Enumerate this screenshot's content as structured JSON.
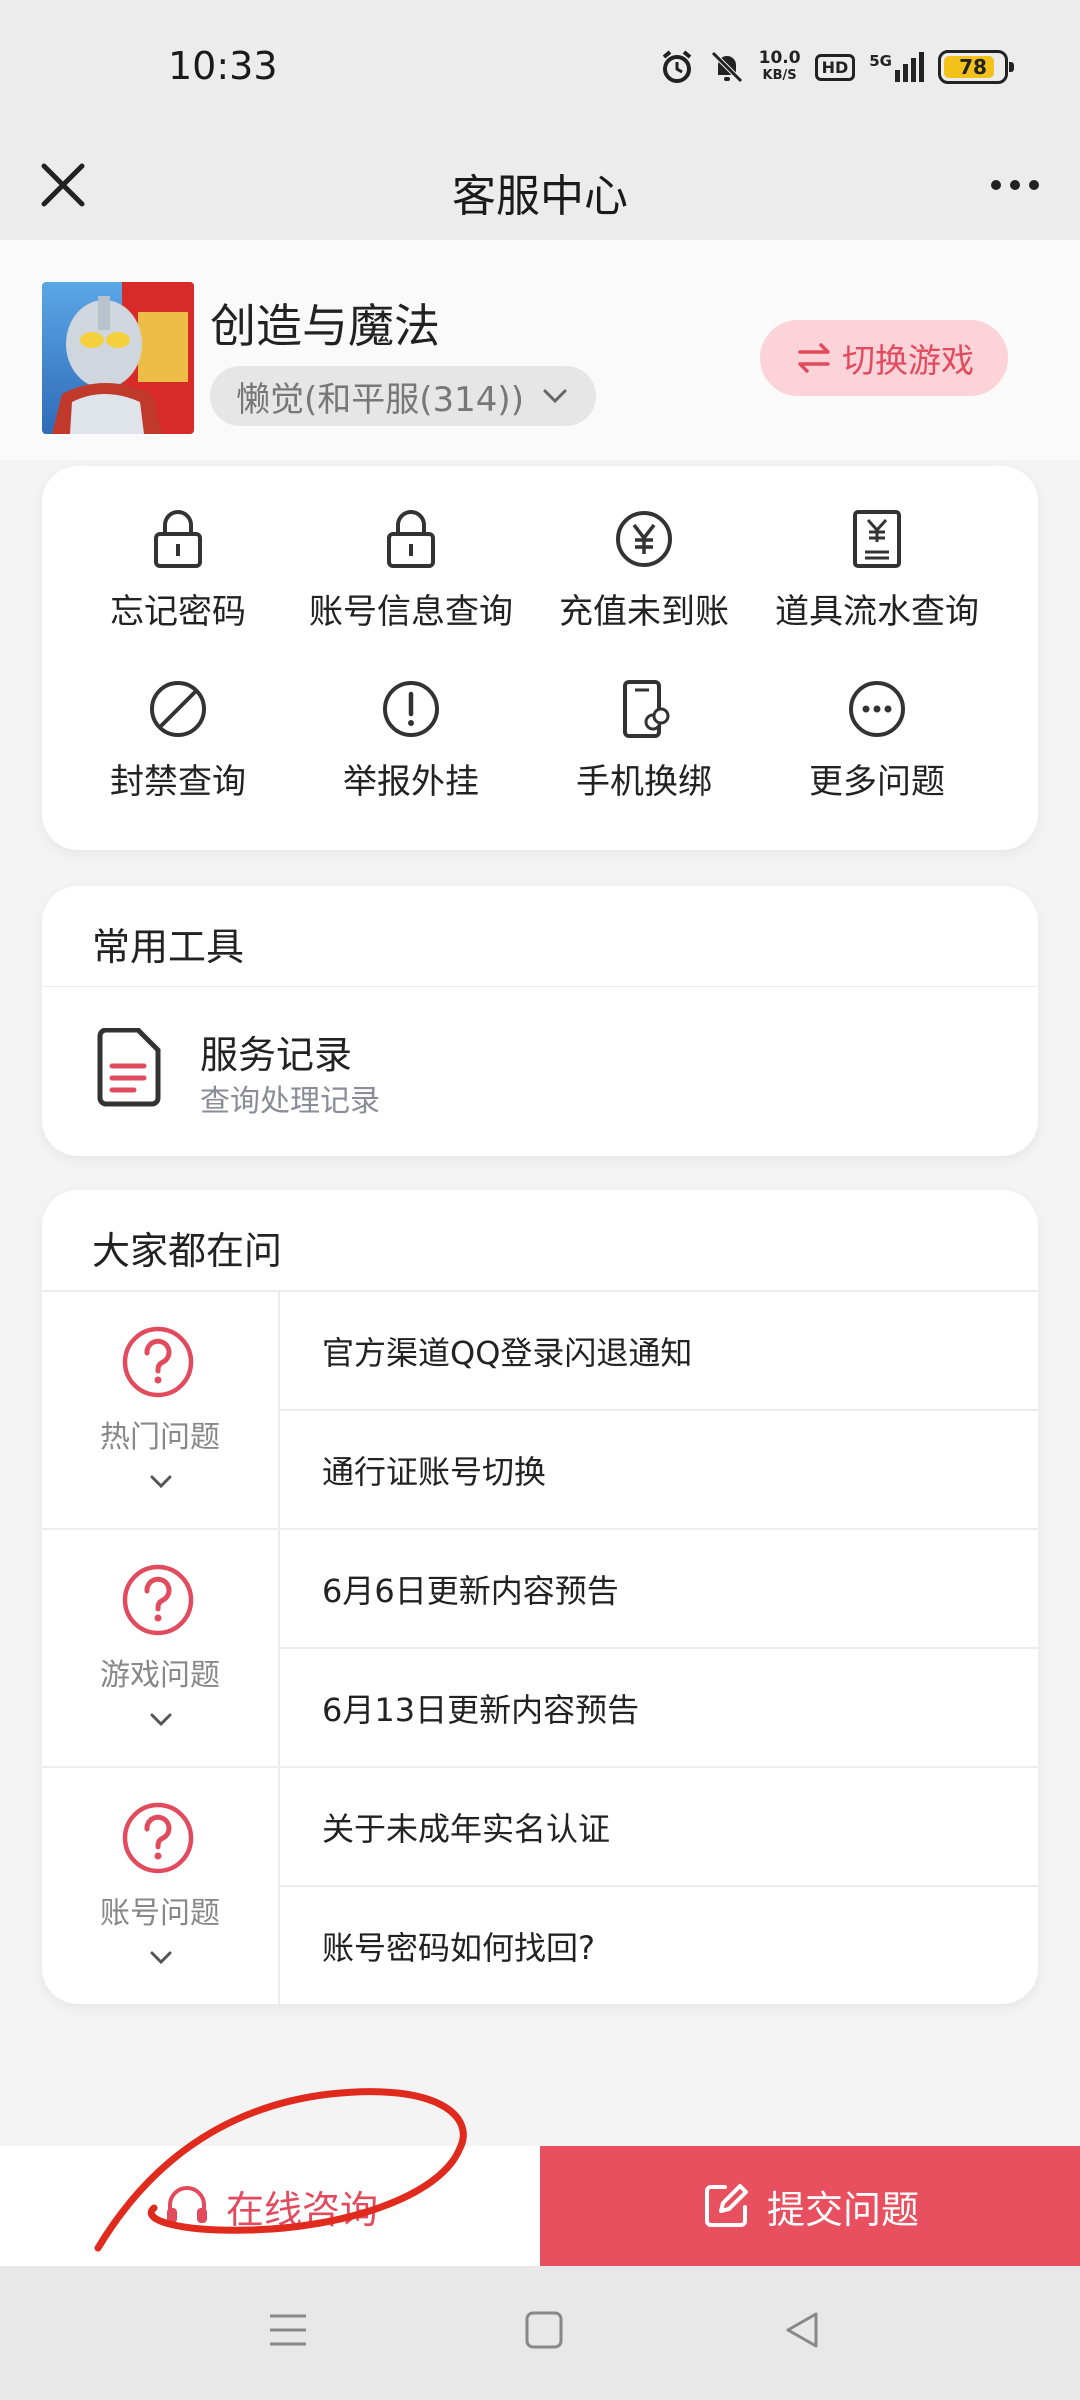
{
  "status_bar": {
    "time": "10:33",
    "net_speed_value": "10.0",
    "net_speed_unit": "KB/S",
    "hd": "HD",
    "signal": "5G",
    "battery": "78"
  },
  "nav": {
    "title": "客服中心"
  },
  "game": {
    "name": "创造与魔法",
    "server": "懒觉(和平服(314))",
    "switch_label": "切换游戏"
  },
  "quick_actions": [
    {
      "label": "忘记密码",
      "icon": "lock-icon"
    },
    {
      "label": "账号信息查询",
      "icon": "lock-icon"
    },
    {
      "label": "充值未到账",
      "icon": "yen-icon"
    },
    {
      "label": "道具流水查询",
      "icon": "receipt-icon"
    },
    {
      "label": "封禁查询",
      "icon": "ban-icon"
    },
    {
      "label": "举报外挂",
      "icon": "alert-icon"
    },
    {
      "label": "手机换绑",
      "icon": "phone-link-icon"
    },
    {
      "label": "更多问题",
      "icon": "more-circle-icon"
    }
  ],
  "tools": {
    "title": "常用工具",
    "items": [
      {
        "name": "服务记录",
        "sub": "查询处理记录",
        "icon": "document-icon"
      }
    ]
  },
  "faq": {
    "title": "大家都在问",
    "categories": [
      {
        "label": "热门问题",
        "questions": [
          "官方渠道QQ登录闪退通知",
          "通行证账号切换"
        ]
      },
      {
        "label": "游戏问题",
        "questions": [
          "6月6日更新内容预告",
          "6月13日更新内容预告"
        ]
      },
      {
        "label": "账号问题",
        "questions": [
          "关于未成年实名认证",
          "账号密码如何找回?"
        ]
      }
    ]
  },
  "bottom": {
    "consult_label": "在线咨询",
    "submit_label": "提交问题"
  },
  "colors": {
    "accent": "#e24b5e",
    "accent_bg": "#fbd3d8",
    "submit_bg": "#e9505f",
    "annotation": "#e02a1e"
  }
}
